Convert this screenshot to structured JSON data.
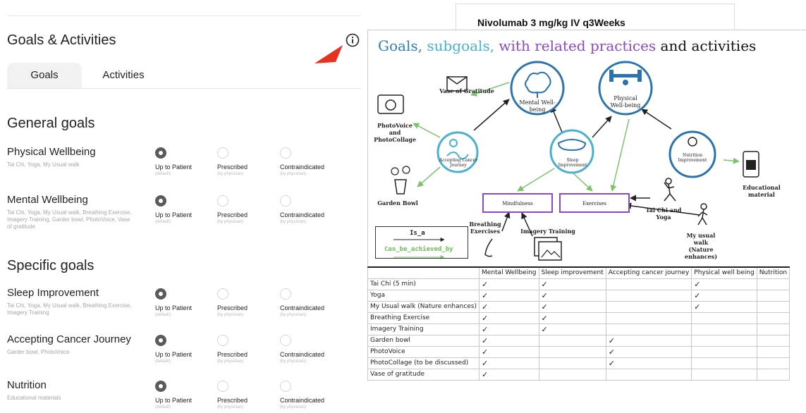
{
  "panel": {
    "title": "Goals & Activities",
    "tabs": [
      "Goals",
      "Activities"
    ],
    "options": [
      {
        "label": "Up to Patient",
        "hint": "(default)"
      },
      {
        "label": "Prescribed",
        "hint": "(by physician)"
      },
      {
        "label": "Contraindicated",
        "hint": "(by physician)"
      }
    ],
    "general_title": "General goals",
    "specific_title": "Specific goals",
    "goals": [
      {
        "title": "Physical Wellbeing",
        "activities": "Tai Chi, Yoga, My Usual walk",
        "selected": 0
      },
      {
        "title": "Mental Wellbeing",
        "activities": "Tai Chi, Yoga, My Usual walk, Breathing Exercise, Imagery Training, Garder bowl, PhotoVoice, Vase of gratitude",
        "selected": 0
      },
      {
        "title": "Sleep Improvement",
        "activities": "Tai Chi, Yoga, My Usual walk, Breathing Exercise, Imagery Training",
        "selected": 0
      },
      {
        "title": "Accepting Cancer Journey",
        "activities": "Garder bowl, PhotoVoice",
        "selected": 0
      },
      {
        "title": "Nutrition",
        "activities": "Educational materials",
        "selected": 0
      }
    ]
  },
  "doc": {
    "header": "Nivolumab 3 mg/kg IV q3Weeks",
    "diagram": {
      "title_parts": [
        "Goals,",
        " subgoals,",
        " with related practices",
        " and activities"
      ],
      "nodes": {
        "mental": "Mental Well-\nbeing",
        "physical": "Physical\nWell-being",
        "accepting": "Accepting Cancer\nJourney",
        "sleep": "Sleep\nImprovement",
        "nutrition": "Nutrition\nImprovement",
        "mindfulness": "Mindfulness",
        "exercises": "Exercises"
      },
      "labels": {
        "vase": "Vase of Gratitude",
        "photovoice": "PhotoVoice\nand\nPhotoCollage",
        "garden": "Garden Bowl",
        "breathing": "Breathing\nExercises",
        "imagery": "Imagery Training",
        "taichi": "Tai Chi and\nYoga",
        "walk": "My usual\nwalk\n(Nature\nenhances)",
        "educational": "Educational\nmaterial"
      },
      "legend": {
        "is_a": "Is_a",
        "can_be": "Can_be_achieved_by"
      }
    },
    "matrix": {
      "columns": [
        "",
        "Mental Wellbeing",
        "Sleep improvement",
        "Accepting cancer journey",
        "Physical well being",
        "Nutrition"
      ],
      "check_mark": "✓",
      "rows": [
        {
          "name": "Tai Chi (5 min)",
          "checks": [
            true,
            true,
            false,
            true,
            false
          ]
        },
        {
          "name": "Yoga",
          "checks": [
            true,
            true,
            false,
            true,
            false
          ]
        },
        {
          "name": "My Usual walk (Nature enhances)",
          "checks": [
            true,
            true,
            false,
            true,
            false
          ]
        },
        {
          "name": "Breathing Exercise",
          "checks": [
            true,
            true,
            false,
            false,
            false
          ]
        },
        {
          "name": "Imagery Training",
          "checks": [
            true,
            true,
            false,
            false,
            false
          ]
        },
        {
          "name": "Garden bowl",
          "checks": [
            true,
            false,
            true,
            false,
            false
          ]
        },
        {
          "name": "PhotoVoice",
          "checks": [
            true,
            false,
            true,
            false,
            false
          ]
        },
        {
          "name": "PhotoCollage (to be discussed)",
          "checks": [
            true,
            false,
            true,
            false,
            false
          ]
        },
        {
          "name": "Vase of gratitude",
          "checks": [
            true,
            false,
            false,
            false,
            false
          ]
        }
      ]
    }
  },
  "colors": {
    "accent_arrow": "#e8311f",
    "node_border": "#2a73ad",
    "purple": "#8b49c9",
    "green_arrow": "#7ac46a"
  }
}
